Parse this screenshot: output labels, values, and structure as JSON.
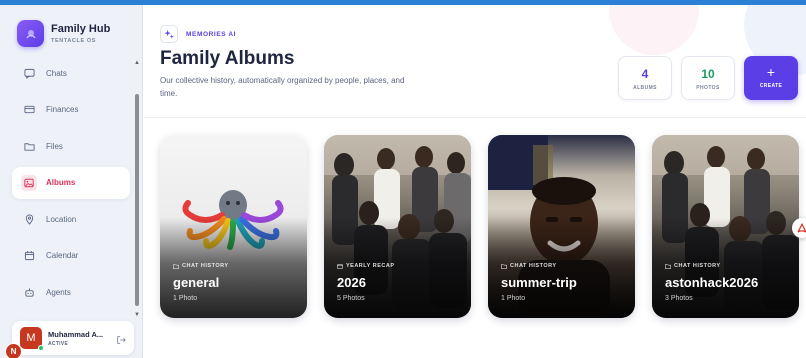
{
  "brand": {
    "title": "Family Hub",
    "subtitle": "TENTACLE OS"
  },
  "sidebar": {
    "items": [
      {
        "label": "Chats",
        "icon": "chat-icon"
      },
      {
        "label": "Finances",
        "icon": "card-icon"
      },
      {
        "label": "Files",
        "icon": "folder-icon"
      },
      {
        "label": "Albums",
        "icon": "image-icon",
        "active": true
      },
      {
        "label": "Location",
        "icon": "pin-icon"
      },
      {
        "label": "Calendar",
        "icon": "calendar-icon"
      },
      {
        "label": "Agents",
        "icon": "bot-icon"
      }
    ]
  },
  "user": {
    "initial": "M",
    "name": "Muhammad A...",
    "status": "ACTIVE",
    "badge_initial": "N"
  },
  "header": {
    "badge": "MEMORIES AI",
    "title": "Family Albums",
    "description": "Our collective history, automatically organized by people, places, and time."
  },
  "stats": [
    {
      "value": "4",
      "label": "ALBUMS",
      "color": "#5b3ee6"
    },
    {
      "value": "10",
      "label": "PHOTOS",
      "color": "#1f9a63"
    }
  ],
  "create": {
    "plus": "+",
    "label": "CREATE"
  },
  "albums": [
    {
      "tag": "CHAT HISTORY",
      "name": "general",
      "count": "1 Photo",
      "style": "octopus"
    },
    {
      "tag": "YEARLY RECAP",
      "name": "2026",
      "count": "5 Photos",
      "style": "crowd"
    },
    {
      "tag": "CHAT HISTORY",
      "name": "summer-trip",
      "count": "1 Photo",
      "style": "selfie"
    },
    {
      "tag": "CHAT HISTORY",
      "name": "astonhack2026",
      "count": "3 Photos",
      "style": "crowd"
    }
  ],
  "colors": {
    "accent": "#5b3ee6",
    "active_nav": "#d6345c",
    "top_bar": "#2b7fd4"
  }
}
